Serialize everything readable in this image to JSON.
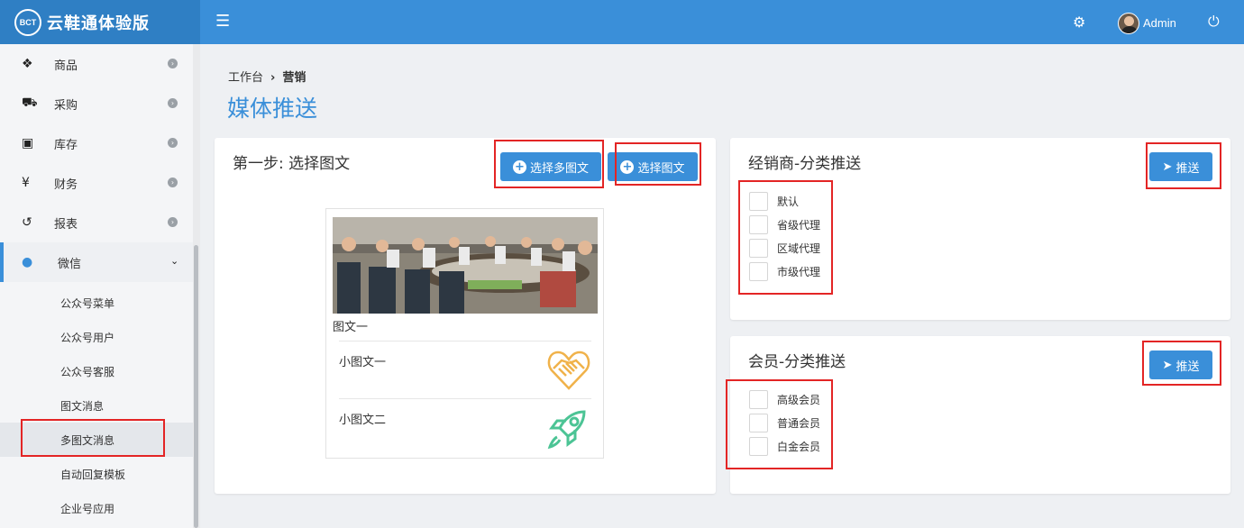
{
  "brand": {
    "logo_text": "BCT",
    "name": "云鞋通体验版"
  },
  "header": {
    "menu_icon": "bars-icon",
    "settings_icon": "gear-icon",
    "user": "Admin",
    "power_icon": "power-icon"
  },
  "sidebar": {
    "items": [
      {
        "label": "商品",
        "icon": "cubes-icon",
        "glyph": "❖"
      },
      {
        "label": "采购",
        "icon": "cart-icon",
        "glyph": "🛒"
      },
      {
        "label": "库存",
        "icon": "archive-icon",
        "glyph": "▣"
      },
      {
        "label": "财务",
        "icon": "yen-icon",
        "glyph": "¥"
      },
      {
        "label": "报表",
        "icon": "history-icon",
        "glyph": "↺"
      },
      {
        "label": "微信",
        "icon": "wechat-icon",
        "glyph": "💬"
      }
    ],
    "wechat_sub": [
      "公众号菜单",
      "公众号用户",
      "公众号客服",
      "图文消息",
      "多图文消息",
      "自动回复模板",
      "企业号应用"
    ],
    "current_sub": "多图文消息"
  },
  "breadcrumb": {
    "home": "工作台",
    "current": "营销"
  },
  "page_title": "媒体推送",
  "step_panel": {
    "title": "第一步: 选择图文",
    "select_multi_label": "选择多图文",
    "select_single_label": "选择图文",
    "news": {
      "main_title": "图文一",
      "subs": [
        {
          "title": "小图文一",
          "icon": "handshake-heart-icon",
          "color": "#f0b24a"
        },
        {
          "title": "小图文二",
          "icon": "rocket-icon",
          "color": "#4cc495"
        }
      ]
    }
  },
  "dealer_panel": {
    "title": "经销商-分类推送",
    "push_label": "推送",
    "options": [
      "默认",
      "省级代理",
      "区域代理",
      "市级代理"
    ]
  },
  "member_panel": {
    "title": "会员-分类推送",
    "push_label": "推送",
    "options": [
      "高级会员",
      "普通会员",
      "白金会员"
    ]
  },
  "colors": {
    "primary": "#3a8fd9",
    "highlight": "#e32525"
  }
}
